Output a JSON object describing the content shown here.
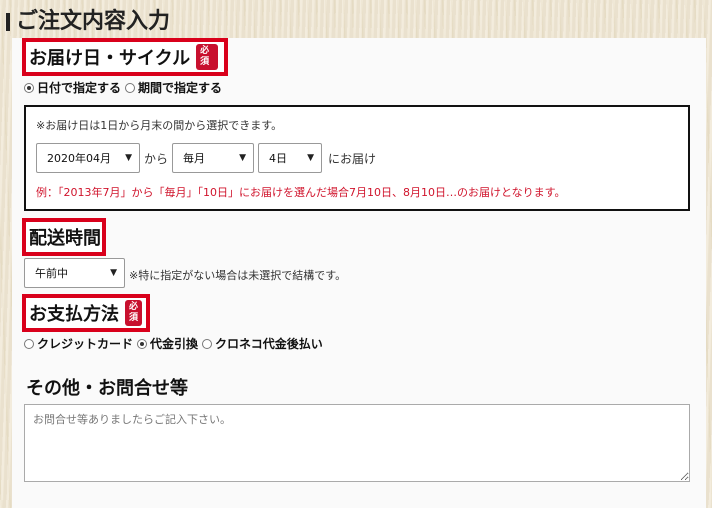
{
  "page": {
    "title": "ご注文内容入力"
  },
  "delivery_cycle": {
    "heading": "お届け日・サイクル",
    "required_badge": "必須",
    "options": [
      "日付で指定する",
      "期間で指定する"
    ],
    "selected": 0,
    "note": "※お届け日は1日から月末の間から選択できます。",
    "month_select": "2020年04月",
    "from_text": "から",
    "cycle_select": "毎月",
    "day_select": "4日",
    "deliver_text": "にお届け",
    "example": "例：「2013年7月」から「毎月」「10日」にお届けを選んだ場合7月10日、8月10日…のお届けとなります。"
  },
  "delivery_time": {
    "heading": "配送時間",
    "select": "午前中",
    "note": "※特に指定がない場合は未選択で結構です。"
  },
  "payment": {
    "heading": "お支払方法",
    "required_badge": "必須",
    "options": [
      "クレジットカード",
      "代金引換",
      "クロネコ代金後払い"
    ],
    "selected": 1
  },
  "other": {
    "heading": "その他・お問合せ等",
    "placeholder": "お問合せ等ありましたらご記入下さい。"
  }
}
